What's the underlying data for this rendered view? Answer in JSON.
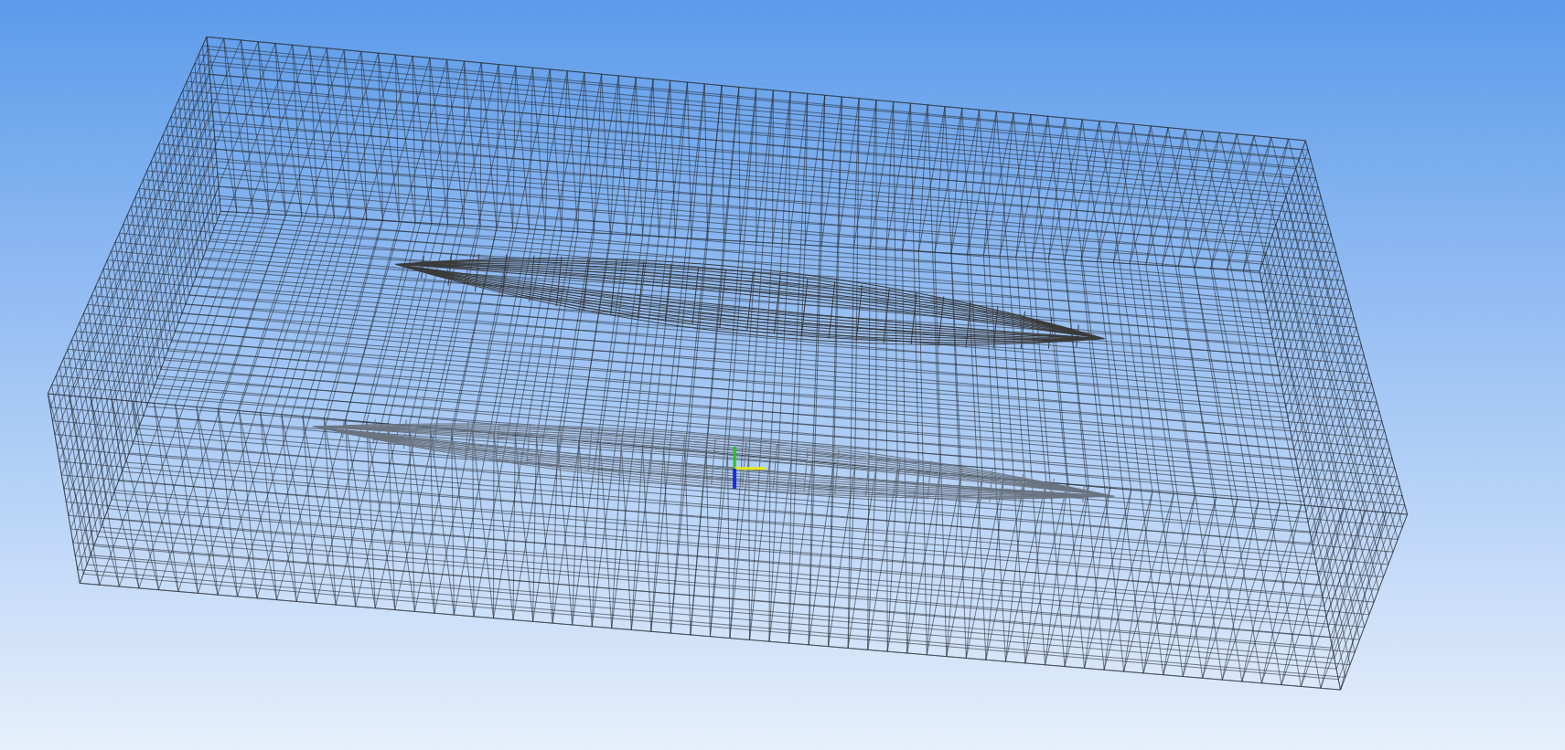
{
  "viewport": {
    "axes_triad": true
  }
}
